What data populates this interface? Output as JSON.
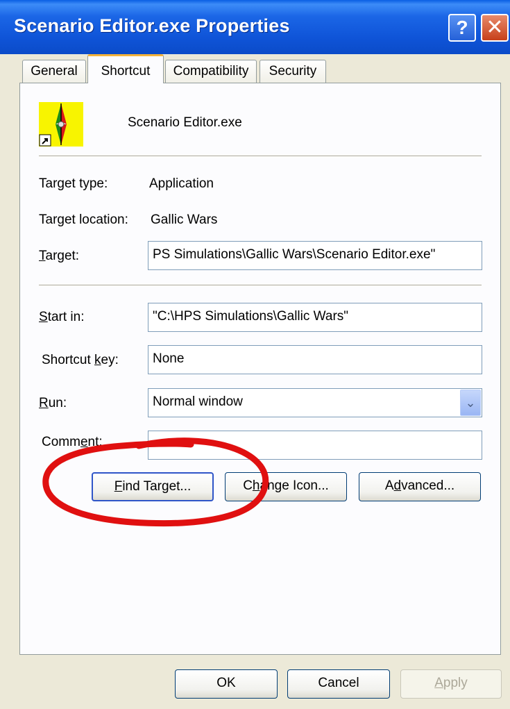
{
  "window": {
    "title": "Scenario Editor.exe Properties",
    "help_glyph": "?",
    "close_glyph": "✕"
  },
  "tabs": [
    {
      "label": "General",
      "selected": false
    },
    {
      "label": "Shortcut",
      "selected": true
    },
    {
      "label": "Compatibility",
      "selected": false
    },
    {
      "label": "Security",
      "selected": false
    }
  ],
  "shortcut": {
    "file_name": "Scenario Editor.exe",
    "target_type": {
      "label": "Target type:",
      "value": "Application"
    },
    "target_location": {
      "label": "Target location:",
      "value": "Gallic Wars"
    },
    "target": {
      "key": "T",
      "rest": "arget:",
      "value": "PS Simulations\\Gallic Wars\\Scenario Editor.exe\""
    },
    "start_in": {
      "key": "S",
      "rest": "tart in:",
      "value": "\"C:\\HPS Simulations\\Gallic Wars\""
    },
    "shortcut_key": {
      "pre": "Shortcut ",
      "key": "k",
      "rest": "ey:",
      "value": "None"
    },
    "run": {
      "key": "R",
      "rest": "un:",
      "value": "Normal window"
    },
    "comment": {
      "pre": "Comm",
      "key": "e",
      "rest": "nt:",
      "value": ""
    }
  },
  "buttons": {
    "find_target": {
      "key": "F",
      "rest": "ind Target..."
    },
    "change_icon": {
      "pre": "C",
      "key": "h",
      "rest": "ange Icon..."
    },
    "advanced": {
      "pre": "A",
      "key": "d",
      "rest": "vanced..."
    },
    "ok": "OK",
    "cancel": "Cancel",
    "apply": {
      "key": "A",
      "rest": "pply",
      "disabled": true
    }
  },
  "colors": {
    "titlebar": "#0a58e0",
    "annotation_circle": "#e01010",
    "tab_highlight": "#f3b23b"
  },
  "icons": {
    "help": "help-icon",
    "close": "close-icon",
    "app": "scenario-editor-app-icon",
    "shortcut_arrow": "shortcut-arrow-icon",
    "dropdown": "chevron-down-icon"
  }
}
